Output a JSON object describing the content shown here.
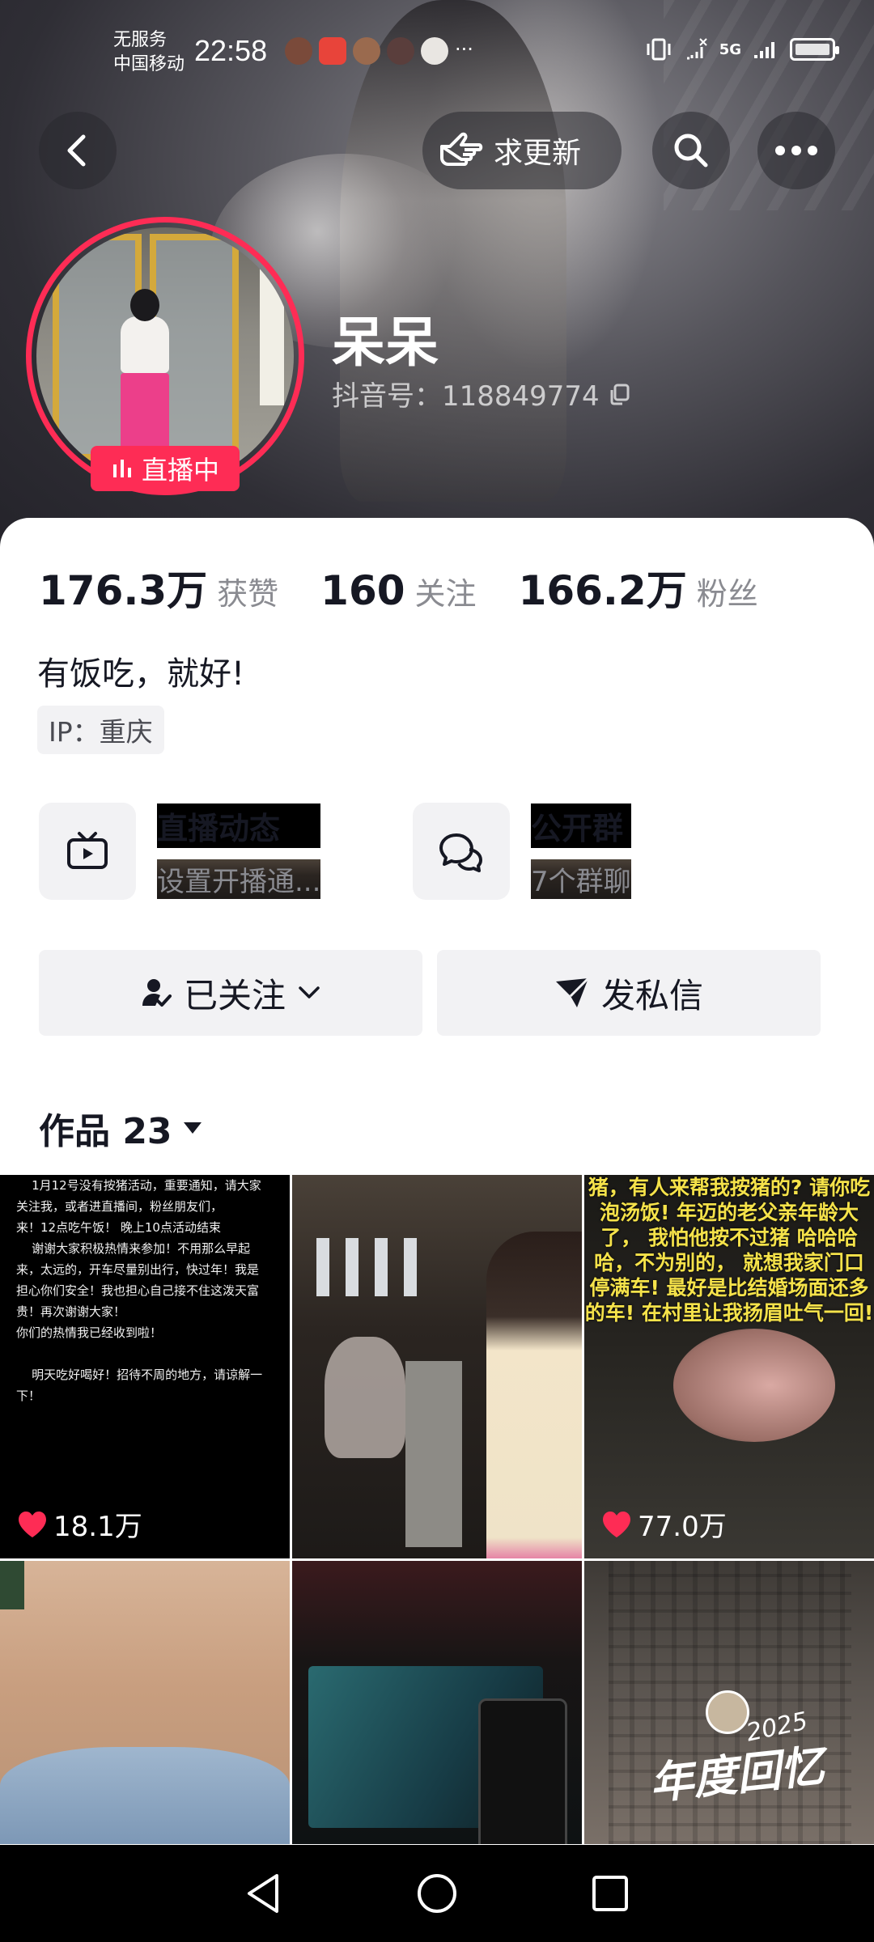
{
  "status_bar": {
    "carrier_line1": "无服务",
    "carrier_line2": "中国移动",
    "time": "22:58",
    "more": "···",
    "network": "5G"
  },
  "header": {
    "request_update_label": "求更新",
    "name": "呆呆",
    "douyin_id": "抖音号：118849774",
    "live_badge": "直播中"
  },
  "stats": [
    {
      "value": "176.3万",
      "label": "获赞"
    },
    {
      "value": "160",
      "label": "关注"
    },
    {
      "value": "166.2万",
      "label": "粉丝"
    }
  ],
  "bio": "有饭吃，就好!",
  "ip_label": "IP：重庆",
  "features": [
    {
      "title": "直播动态",
      "subtitle": "设置开播通...",
      "icon": "tv-icon"
    },
    {
      "title": "公开群",
      "subtitle": "7个群聊",
      "icon": "chat-bubbles-icon"
    }
  ],
  "actions": {
    "follow_label": "已关注",
    "message_label": "发私信"
  },
  "works_tab": {
    "label": "作品 23"
  },
  "grid": {
    "tile1_text": "    1月12号没有按猪活动，重要通知，请大家\n关注我，或者进直播间，粉丝朋友们，\n来！12点吃午饭！ 晚上10点活动结束\n    谢谢大家积极热情来参加！不用那么早起\n来，太远的，开车尽量别出行，快过年！我是\n担心你们安全！我也担心自己接不住这泼天富\n贵！再次谢谢大家！\n你们的热情我已经收到啦！\n\n    明天吃好喝好！招待不周的地方，请谅解一\n下！",
    "tile1_likes": "18.1万",
    "tile3_text": "猪，有人来帮我按猪的?\n请你吃泡汤饭!\n年迈的老父亲年龄大了，\n我怕他按不过猪\n哈哈哈哈，不为别的，\n就想我家门口停满车!\n最好是比结婚场面还多的车!\n在村里让我扬眉吐气一回!",
    "tile3_likes": "77.0万",
    "tile6_recap": "年度回忆",
    "tile6_year": "2025"
  },
  "colors": {
    "accent": "#fe2c55",
    "text_primary": "#161823",
    "text_secondary": "#8a8b91",
    "chip_bg": "#f2f2f4"
  }
}
